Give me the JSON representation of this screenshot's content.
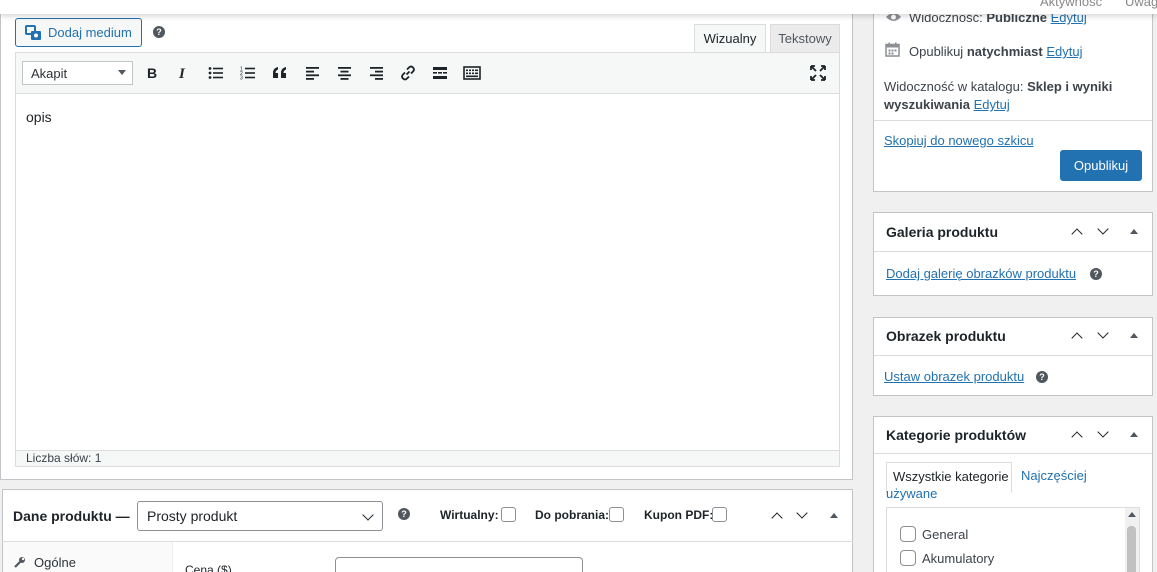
{
  "topbar": {
    "activity": "Aktywność",
    "notices": "Uwag"
  },
  "editor": {
    "add_media_label": "Dodaj medium",
    "tab_visual": "Wizualny",
    "tab_text": "Tekstowy",
    "format_select": "Akapit",
    "content": "opis",
    "word_count": "Liczba słów: 1",
    "toolbar_icons": [
      "bold-icon",
      "italic-icon",
      "bullet-list-icon",
      "numbered-list-icon",
      "blockquote-icon",
      "align-left-icon",
      "align-center-icon",
      "align-right-icon",
      "link-icon",
      "read-more-icon",
      "toolbar-toggle-icon",
      "fullscreen-icon"
    ]
  },
  "product_data": {
    "title": "Dane produktu —",
    "type_select": "Prosty produkt",
    "virtual_label": "Wirtualny:",
    "downloadable_label": "Do pobrania:",
    "pdf_coupon_label": "Kupon PDF:",
    "tab_general": "Ogólne",
    "price_label": "Cena ($)"
  },
  "publish": {
    "visibility_label": "Widoczność:",
    "visibility_value": "Publiczne",
    "visibility_edit": "Edytuj",
    "publish_label": "Opublikuj",
    "publish_value": "natychmiast",
    "publish_edit": "Edytuj",
    "catalog_label": "Widoczność w katalogu:",
    "catalog_value_1": "Sklep i wyniki",
    "catalog_value_2": "wyszukiwania",
    "catalog_edit": "Edytuj",
    "copy_draft": "Skopiuj do nowego szkicu",
    "publish_button": "Opublikuj"
  },
  "gallery": {
    "title": "Galeria produktu",
    "add_link": "Dodaj galerię obrazków produktu"
  },
  "image": {
    "title": "Obrazek produktu",
    "set_link": "Ustaw obrazek produktu"
  },
  "categories": {
    "title": "Kategorie produktów",
    "tab_all": "Wszystkie kategorie",
    "tab_popular_1": "Najczęściej",
    "tab_popular_2": "używane",
    "items": [
      "General",
      "Akumulatory"
    ]
  },
  "colors": {
    "accent": "#2271b1",
    "border": "#c3c4c7",
    "background": "#f0f0f1"
  }
}
